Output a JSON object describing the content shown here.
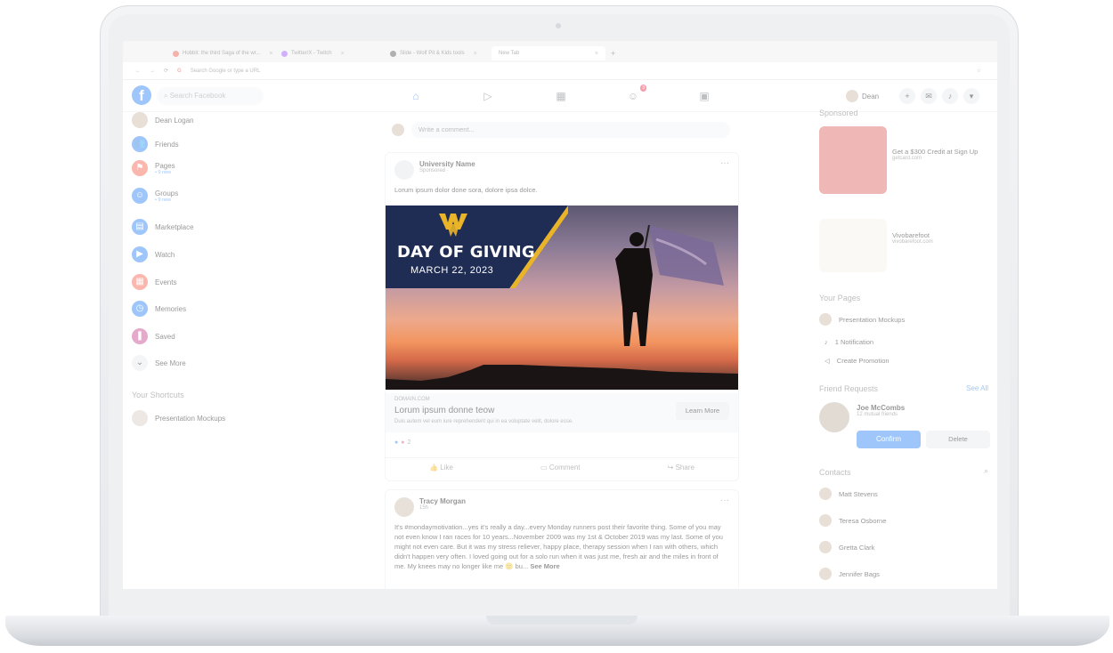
{
  "browser": {
    "tabs": [
      {
        "label": "Hobbit: the third Saga of the wr..."
      },
      {
        "label": "Twitter/X - Twitch"
      },
      {
        "label": "Slide - Wolf Pit & Kids tools"
      },
      {
        "label": "New Tab"
      }
    ],
    "url_placeholder": "Search Google or type a URL"
  },
  "fb": {
    "search_placeholder": "Search Facebook",
    "notif_badge": "3",
    "user_name": "Dean"
  },
  "left": {
    "profile_name": "Dean Logan",
    "items": [
      {
        "label": "Friends",
        "icon": "friends-icon",
        "color": "#1877f2"
      },
      {
        "label": "Pages",
        "sub": "• 9 new",
        "icon": "flag-icon",
        "color": "#f5533d"
      },
      {
        "label": "Groups",
        "sub": "• 9 new",
        "icon": "groups-icon",
        "color": "#1877f2"
      },
      {
        "label": "Marketplace",
        "icon": "store-icon",
        "color": "#1877f2"
      },
      {
        "label": "Watch",
        "icon": "watch-icon",
        "color": "#1877f2"
      },
      {
        "label": "Events",
        "icon": "calendar-icon",
        "color": "#f5533d"
      },
      {
        "label": "Memories",
        "icon": "clock-icon",
        "color": "#1877f2"
      },
      {
        "label": "Saved",
        "icon": "bookmark-icon",
        "color": "#c13584"
      },
      {
        "label": "See More",
        "icon": "chevron-down-icon",
        "color": "#e4e6eb"
      }
    ],
    "shortcuts_title": "Your Shortcuts",
    "shortcut": "Presentation Mockups"
  },
  "feed": {
    "comment_placeholder": "Write a comment...",
    "ad_post": {
      "page_name": "University Name",
      "meta": "Sponsored ·",
      "text": "Lorum ipsum dolor done sora, dolore ipsa dolce.",
      "image_title": "DAY OF GIVING",
      "image_date": "MARCH 22, 2023",
      "link_domain": "DOMAIN.COM",
      "link_title": "Lorum ipsum donne teow",
      "link_desc": "Duis autem vel eum iure reprehenderit qui in ea voluptate velit, dolore esse.",
      "cta": "Learn More",
      "reaction_count": "2",
      "like": "Like",
      "comment": "Comment",
      "share": "Share"
    },
    "post2": {
      "name": "Tracy Morgan",
      "meta": "15h · ",
      "text": "It's #mondaymotivation...yes it's really a day...every Monday runners post their favorite thing. Some of you may not even know I ran races for 10 years...November 2009 was my 1st & October 2019 was my last. Some of you might not even care. But it was my stress reliever, happy place, therapy session when I ran with others, which didn't happen very often. I loved going out for a solo run when it was just me, fresh air and the miles in front of me. My knees may no longer like me 🙂 bu...",
      "see_more": "See More"
    }
  },
  "right": {
    "sponsored_title": "Sponsored",
    "ad1_title": "Get a $300 Credit at Sign Up",
    "ad1_domain": "getcard.com",
    "ad2_title": "Vivobarefoot",
    "ad2_domain": "vivobarefoot.com",
    "pages_title": "Your Pages",
    "page_name": "Presentation Mockups",
    "page_notif": "1 Notification",
    "page_promo": "Create Promotion",
    "requests_title": "Friend Requests",
    "see_all": "See All",
    "request_name": "Joe McCombs",
    "request_mutual": "12 mutual friends",
    "confirm": "Confirm",
    "delete": "Delete",
    "contacts_title": "Contacts",
    "contacts": [
      "Matt Stevens",
      "Teresa Osborne",
      "Gretta Clark",
      "Jennifer Bags"
    ]
  }
}
